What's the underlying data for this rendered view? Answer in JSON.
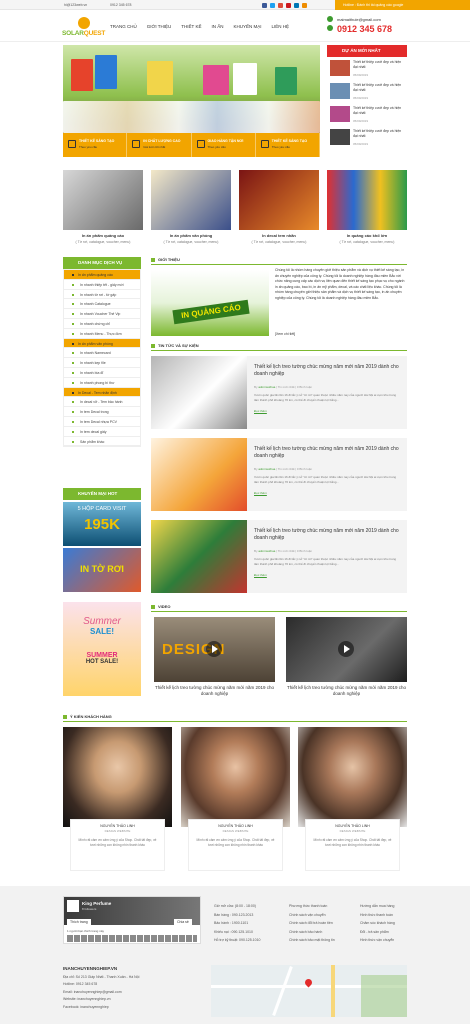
{
  "topbar": {
    "email": "hi@123web.vn",
    "phone": "0912 345 678",
    "hotline_text": "Hotline : Đánh thi tài quảng cáo google"
  },
  "header": {
    "logo_text_1": "SOLAR",
    "logo_text_2": "QUEST",
    "nav": [
      "TRANG CHỦ",
      "GIỚI THIỆU",
      "THIẾT KẾ",
      "IN ẤN",
      "KHUYẾN MẠI",
      "LIÊN HỆ"
    ],
    "contact_email": "maimaithuie@gmail.com",
    "contact_phone": "0912 345 678"
  },
  "hero": {
    "features": [
      {
        "title": "THIẾT KẾ SÁNG TẠO",
        "sub": "Theo yêu cầu"
      },
      {
        "title": "IN CHẤT LƯỢNG CAO",
        "sub": "Giá luôn tốt nhất"
      },
      {
        "title": "GIAO HÀNG TẬN NƠI",
        "sub": "Theo yêu cầu"
      },
      {
        "title": "THIẾT KẾ SÁNG TẠO",
        "sub": "Theo yêu cầu"
      }
    ]
  },
  "featured_news": {
    "title": "DỰ ÁN MỚI NHẤT",
    "items": [
      {
        "title": "Thiết kế thiệp cưới đẹp và hiện đại nhất",
        "date": "05/09/2019"
      },
      {
        "title": "Thiết kế thiệp cưới đẹp và hiện đại nhất",
        "date": "05/09/2019"
      },
      {
        "title": "Thiết kế thiệp cưới đẹp và hiện đại nhất",
        "date": "05/09/2019"
      },
      {
        "title": "Thiết kế thiệp cưới đẹp và hiện đại nhất",
        "date": "05/09/2019"
      }
    ]
  },
  "categories": [
    {
      "title": "In ấn phẩm quảng cáo",
      "sub": "( Tờ rơi, catalogue, voucher, menu)"
    },
    {
      "title": "In ấn phẩm văn phòng",
      "sub": "( Tờ rơi, catalogue, voucher, menu)"
    },
    {
      "title": "In decal tem nhãn",
      "sub": "( Tờ rơi, catalogue, voucher, menu)"
    },
    {
      "title": "In quảng cáo khổ lớn",
      "sub": "( Tờ rơi, catalogue, voucher, menu)"
    }
  ],
  "sidebar": {
    "title": "DANH MỤC DỊCH VỤ",
    "items": [
      {
        "label": "In ấn phẩm quảng cáo",
        "hl": true
      },
      {
        "label": "In nhanh thiệp tết - giấy mời",
        "hl": false
      },
      {
        "label": "In nhanh tờ rơi - tờ gấp",
        "hl": false
      },
      {
        "label": "In nhanh Catalogue",
        "hl": false
      },
      {
        "label": "In nhanh Voucher Thẻ Vip",
        "hl": false
      },
      {
        "label": "In nhanh chứng chỉ",
        "hl": false
      },
      {
        "label": "In nhanh Menu - Thực đơn",
        "hl": false
      },
      {
        "label": "In ấn phẩm văn phòng",
        "hl": true
      },
      {
        "label": "In nhanh Namecard",
        "hl": false
      },
      {
        "label": "In nhanh kẹp file",
        "hl": false
      },
      {
        "label": "In nhanh bìa đĩ",
        "hl": false
      },
      {
        "label": "In nhanh phong bì thư",
        "hl": false
      },
      {
        "label": "In Decal - Tem nhãn định",
        "hl": true
      },
      {
        "label": "In decal vỡ - Tem bảo hành",
        "hl": false
      },
      {
        "label": "In tem Decal trong",
        "hl": false
      },
      {
        "label": "In tem Decal nhựa PCV",
        "hl": false
      },
      {
        "label": "In tem decal giấy",
        "hl": false
      },
      {
        "label": "Sản phẩm khác",
        "hl": false
      }
    ],
    "promo_title": "KHUYẾN MẠI HOT",
    "promo1_line1": "5 HỘP CARD VISIT",
    "promo1_line2": "195K",
    "promo2_line1": "IN TỜ RƠI",
    "promo3_line1": "Summer",
    "promo3_line2": "SALE!",
    "promo3_line3": "SUMMER",
    "promo3_line4": "HOT SALE!"
  },
  "intro": {
    "title": "GIỚI THIỆU",
    "banner_text": "IN QUẢNG CÁO",
    "text": "Chúng tôi là nhóm hàng chuyên giới thiệu sản phẩm và dịch vụ thiết kế sáng tạo, in ấn chuyên nghiệp của công ty. Chúng tôi là doanh nghiệp hàng đầu miền Bắc với chức năng cung cấp các dịch vụ liên quan đến thiết kế sáng tạo phục vụ cho ngành in ấn quảng cáo, bao bì, in ấn mỹ phẩm, decal, và các chất liệu khác. Chúng tôi là nhóm hàng chuyên giới thiệu sản phẩm và dịch vụ thiết kế sáng tạo, in ấn chuyên nghiệp của công ty. Chúng tôi là doanh nghiệp hàng đầu miền Bắc.",
    "more": "[Xem chi tiết]"
  },
  "news": {
    "title": "TIN TỨC VÀ SỰ KIỆN",
    "items": [
      {
        "title": "Thiết kế lịch treo tường chúc mừng năm mới năm 2019 dành cho doanh nghiệp",
        "author": "adminsolhua",
        "date": "Tin mới nhất",
        "comments": "0 Bình luận",
        "desc": "Vươn quốc gia lần lần 16 đi lắc ý nở “tờ rơi” quan thuộc nhiều năm nay của người Hà Nội ai cụm khu trung tâm thành phố khoảng 70 km, có thể đi chuyển thuận lợi bằng...",
        "read": "Đọc thêm"
      },
      {
        "title": "Thiết kế lịch treo tường chúc mừng năm mới năm 2019 dành cho doanh nghiệp",
        "author": "adminsolhua",
        "date": "Tin mới nhất",
        "comments": "0 Bình luận",
        "desc": "Vươn quốc gia lần lần 16 đi lắc ý nở “tờ rơi” quan thuộc nhiều năm nay của người Hà Nội ai cụm khu trung tâm thành phố khoảng 70 km, có thể đi chuyển thuận lợi bằng...",
        "read": "Đọc thêm"
      },
      {
        "title": "Thiết kế lịch treo tường chúc mừng năm mới năm 2019 dành cho doanh nghiệp",
        "author": "adminsolhua",
        "date": "Tin mới nhất",
        "comments": "0 Bình luận",
        "desc": "Vươn quốc gia lần lần 16 đi lắc ý nở “tờ rơi” quan thuộc nhiều năm nay của người Hà Nội ai cụm khu trung tâm thành phố khoảng 70 km, có thể đi chuyển thuận lợi bằng...",
        "read": "Đọc thêm"
      }
    ]
  },
  "video": {
    "title": "VIDEO",
    "items": [
      {
        "title": "Thiết kế lịch treo tường chúc mừng năm mới năm 2019 cho doanh nghiệp",
        "label": "DESIGN"
      },
      {
        "title": "Thiết kế lịch treo tường chúc mừng năm mới năm 2019 cho doanh nghiệp",
        "label": ""
      }
    ]
  },
  "customers": {
    "title": "Ý KIẾN KHÁCH HÀNG",
    "items": [
      {
        "name": "NGUYỄN THẢO LINH",
        "role": "DESIGN WEBSITE",
        "quote": "Mình rất cảm ơn cảm ứng ý của Shop. Chất tất đẹp, vẻ tươi những con không nhìn thanh khác"
      },
      {
        "name": "NGUYỄN THẢO LINH",
        "role": "DESIGN WEBSITE",
        "quote": "Mình rất cảm ơn cảm ứng ý của Shop. Chất tất đẹp, vẻ tươi những con không nhìn thanh khác"
      },
      {
        "name": "NGUYỄN THẢO LINH",
        "role": "DESIGN WEBSITE",
        "quote": "Mình rất cảm ơn cảm ứng ý của Shop. Chất tất đẹp, vẻ tươi những con không nhìn thanh khác"
      }
    ]
  },
  "footer": {
    "fb_name": "King Perfume",
    "fb_likes": "8 followers",
    "fb_like": "Thích trang",
    "fb_share": "Chia sẻ",
    "fb_friends": "1 người bạn thích trang này",
    "col1": [
      "Giờ mở cửa: (8:00 - 18:00)",
      "Bán hàng : 090.123.2013",
      "Bảo hành : 1900.1101",
      "Khiếu nại : 090.125.1010",
      "Hỗ trợ kỹ thuật: 090.125.1010"
    ],
    "col2": [
      "Phương thức thanh toán",
      "Chính sách vận chuyển",
      "Chính sách đổi trả hoàn tiền",
      "Chính sách bảo hành",
      "Chính sách bảo mật thông tin"
    ],
    "col3": [
      "Hướng dẫn mua hàng",
      "Hình thức thanh toán",
      "Chăm sóc khách hàng",
      "Đổi - trả sản phẩm",
      "Hình thức vận chuyển"
    ],
    "company": "INANCHUYENNGHIEP.VN",
    "address": "Địa chỉ: Số 213 Giáp Nhất - Thanh Xuân - Hà Nội",
    "hotline": "Hotline: 0912 345 678",
    "email": "Email: inanchuyennghiep@gmail.com",
    "website": "Website: inanchuyennghiep.vn",
    "facebook": "Facebook: inanchuyennghiep"
  },
  "colors": {
    "green": "#7cb82f",
    "orange": "#f2a500",
    "red": "#e32b2b"
  }
}
